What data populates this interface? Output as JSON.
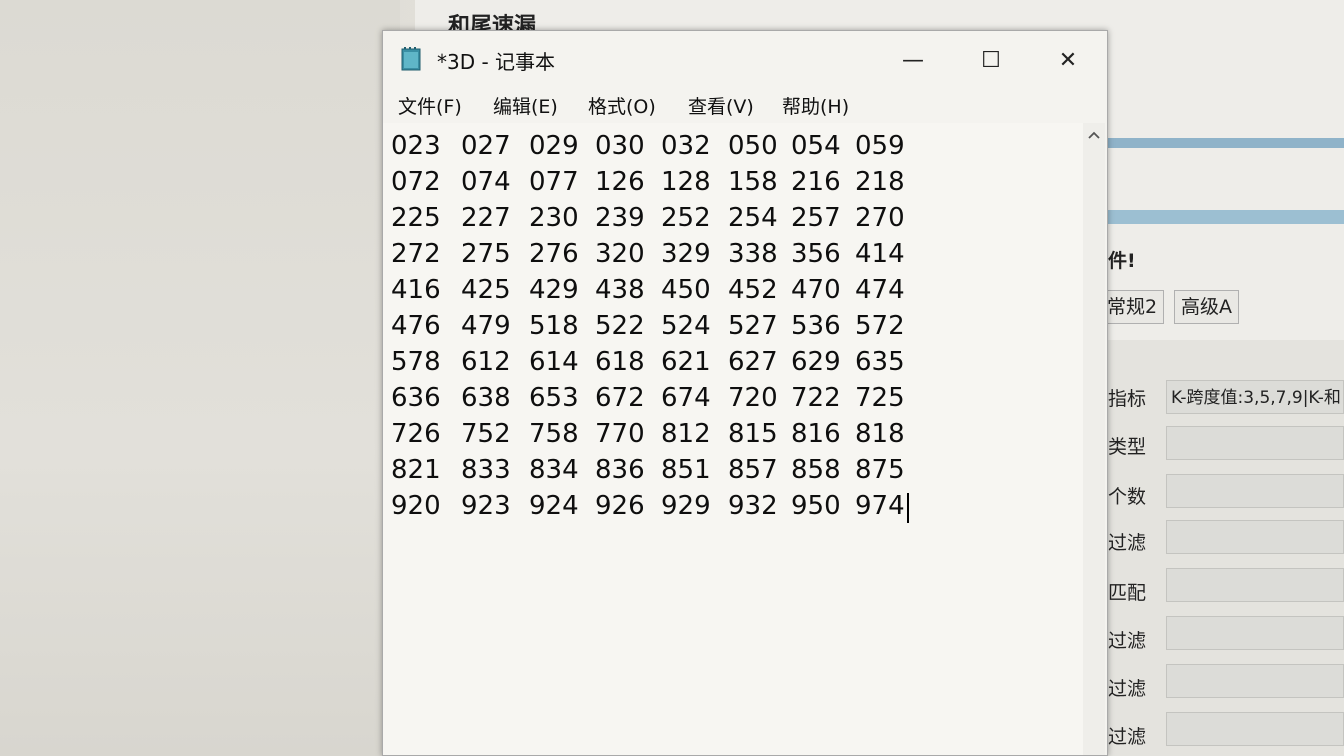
{
  "background": {
    "back_window_title": "和尾速漏",
    "notice_text": "件!",
    "tabs": [
      "常规2",
      "高级A"
    ],
    "rows": [
      {
        "label": "指标",
        "value": "K-跨度值:3,5,7,9|K-和"
      },
      {
        "label": "类型",
        "value": ""
      },
      {
        "label": "个数",
        "value": ""
      },
      {
        "label": "过滤",
        "value": ""
      },
      {
        "label": "匹配",
        "value": ""
      },
      {
        "label": "过滤",
        "value": ""
      },
      {
        "label": "过滤",
        "value": ""
      },
      {
        "label": "过滤",
        "value": ""
      }
    ]
  },
  "notepad": {
    "title": "*3D - 记事本",
    "icon": "notepad-icon",
    "buttons": {
      "minimize": "—",
      "maximize": "☐",
      "close": "✕"
    },
    "menu": [
      "文件(F)",
      "编辑(E)",
      "格式(O)",
      "查看(V)",
      "帮助(H)"
    ],
    "content_rows": [
      [
        "023",
        "027",
        "029",
        "030",
        "032",
        "050",
        "054",
        "059"
      ],
      [
        "072",
        "074",
        "077",
        "126",
        "128",
        "158",
        "216",
        "218"
      ],
      [
        "225",
        "227",
        "230",
        "239",
        "252",
        "254",
        "257",
        "270"
      ],
      [
        "272",
        "275",
        "276",
        "320",
        "329",
        "338",
        "356",
        "414"
      ],
      [
        "416",
        "425",
        "429",
        "438",
        "450",
        "452",
        "470",
        "474"
      ],
      [
        "476",
        "479",
        "518",
        "522",
        "524",
        "527",
        "536",
        "572"
      ],
      [
        "578",
        "612",
        "614",
        "618",
        "621",
        "627",
        "629",
        "635"
      ],
      [
        "636",
        "638",
        "653",
        "672",
        "674",
        "720",
        "722",
        "725"
      ],
      [
        "726",
        "752",
        "758",
        "770",
        "812",
        "815",
        "816",
        "818"
      ],
      [
        "821",
        "833",
        "834",
        "836",
        "851",
        "857",
        "858",
        "875"
      ],
      [
        "920",
        "923",
        "924",
        "926",
        "929",
        "932",
        "950",
        "974"
      ]
    ]
  }
}
